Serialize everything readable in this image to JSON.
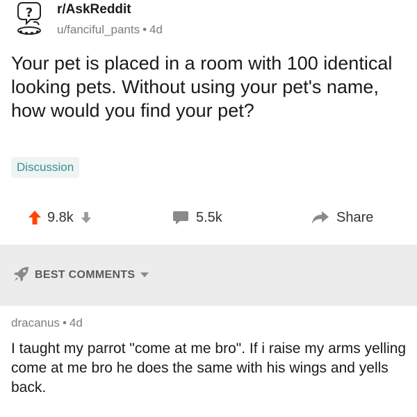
{
  "post": {
    "subreddit": "r/AskReddit",
    "author": "u/fanciful_pants",
    "separator": "•",
    "age": "4d",
    "title": "Your pet is placed in a room with 100 identical looking pets. Without using your pet's name, how would you find your pet?",
    "flair": "Discussion"
  },
  "actions": {
    "upvote_icon": "arrow-up-icon",
    "downvote_icon": "arrow-down-icon",
    "score": "9.8k",
    "comment_icon": "comment-bubble-icon",
    "comment_count": "5.5k",
    "share_icon": "share-arrow-icon",
    "share_label": "Share",
    "upvote_color": "#ff4500"
  },
  "sort": {
    "icon": "rocket-icon",
    "label": "BEST COMMENTS",
    "caret_icon": "caret-down-icon"
  },
  "comment": {
    "author": "dracanus",
    "separator": "•",
    "age": "4d",
    "body": "I taught my parrot \"come at me bro\". If i raise my arms yelling come at me bro he does the same with his wings and yells back."
  }
}
